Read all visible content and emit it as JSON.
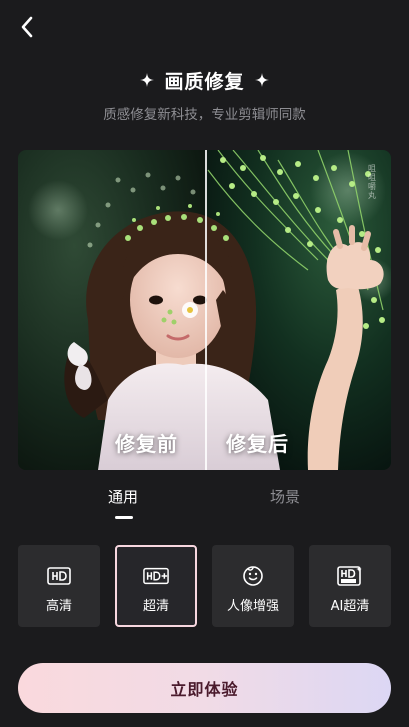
{
  "header": {
    "back_icon": "chevron-left-icon",
    "title": "画质修复",
    "subtitle": "质感修复新科技，专业剪辑师同款"
  },
  "preview": {
    "before_label": "修复前",
    "after_label": "修复后",
    "watermark": "咀咀嚼丸"
  },
  "tabs": [
    {
      "label": "通用",
      "active": true
    },
    {
      "label": "场景",
      "active": false
    }
  ],
  "options": [
    {
      "label": "高清",
      "icon": "hd-icon",
      "selected": false
    },
    {
      "label": "超清",
      "icon": "hd-plus-icon",
      "selected": true
    },
    {
      "label": "人像增强",
      "icon": "face-icon",
      "selected": false
    },
    {
      "label": "AI超清",
      "icon": "hd-ultra-icon",
      "selected": false
    }
  ],
  "cta": {
    "label": "立即体验"
  },
  "colors": {
    "background": "#1b1b1d",
    "card": "#2c2c2e",
    "selected_border": "#f7d7df",
    "cta_gradient_start": "#fad9dd",
    "cta_gradient_end": "#dcd7f4",
    "cta_text": "#4a1a2c"
  }
}
